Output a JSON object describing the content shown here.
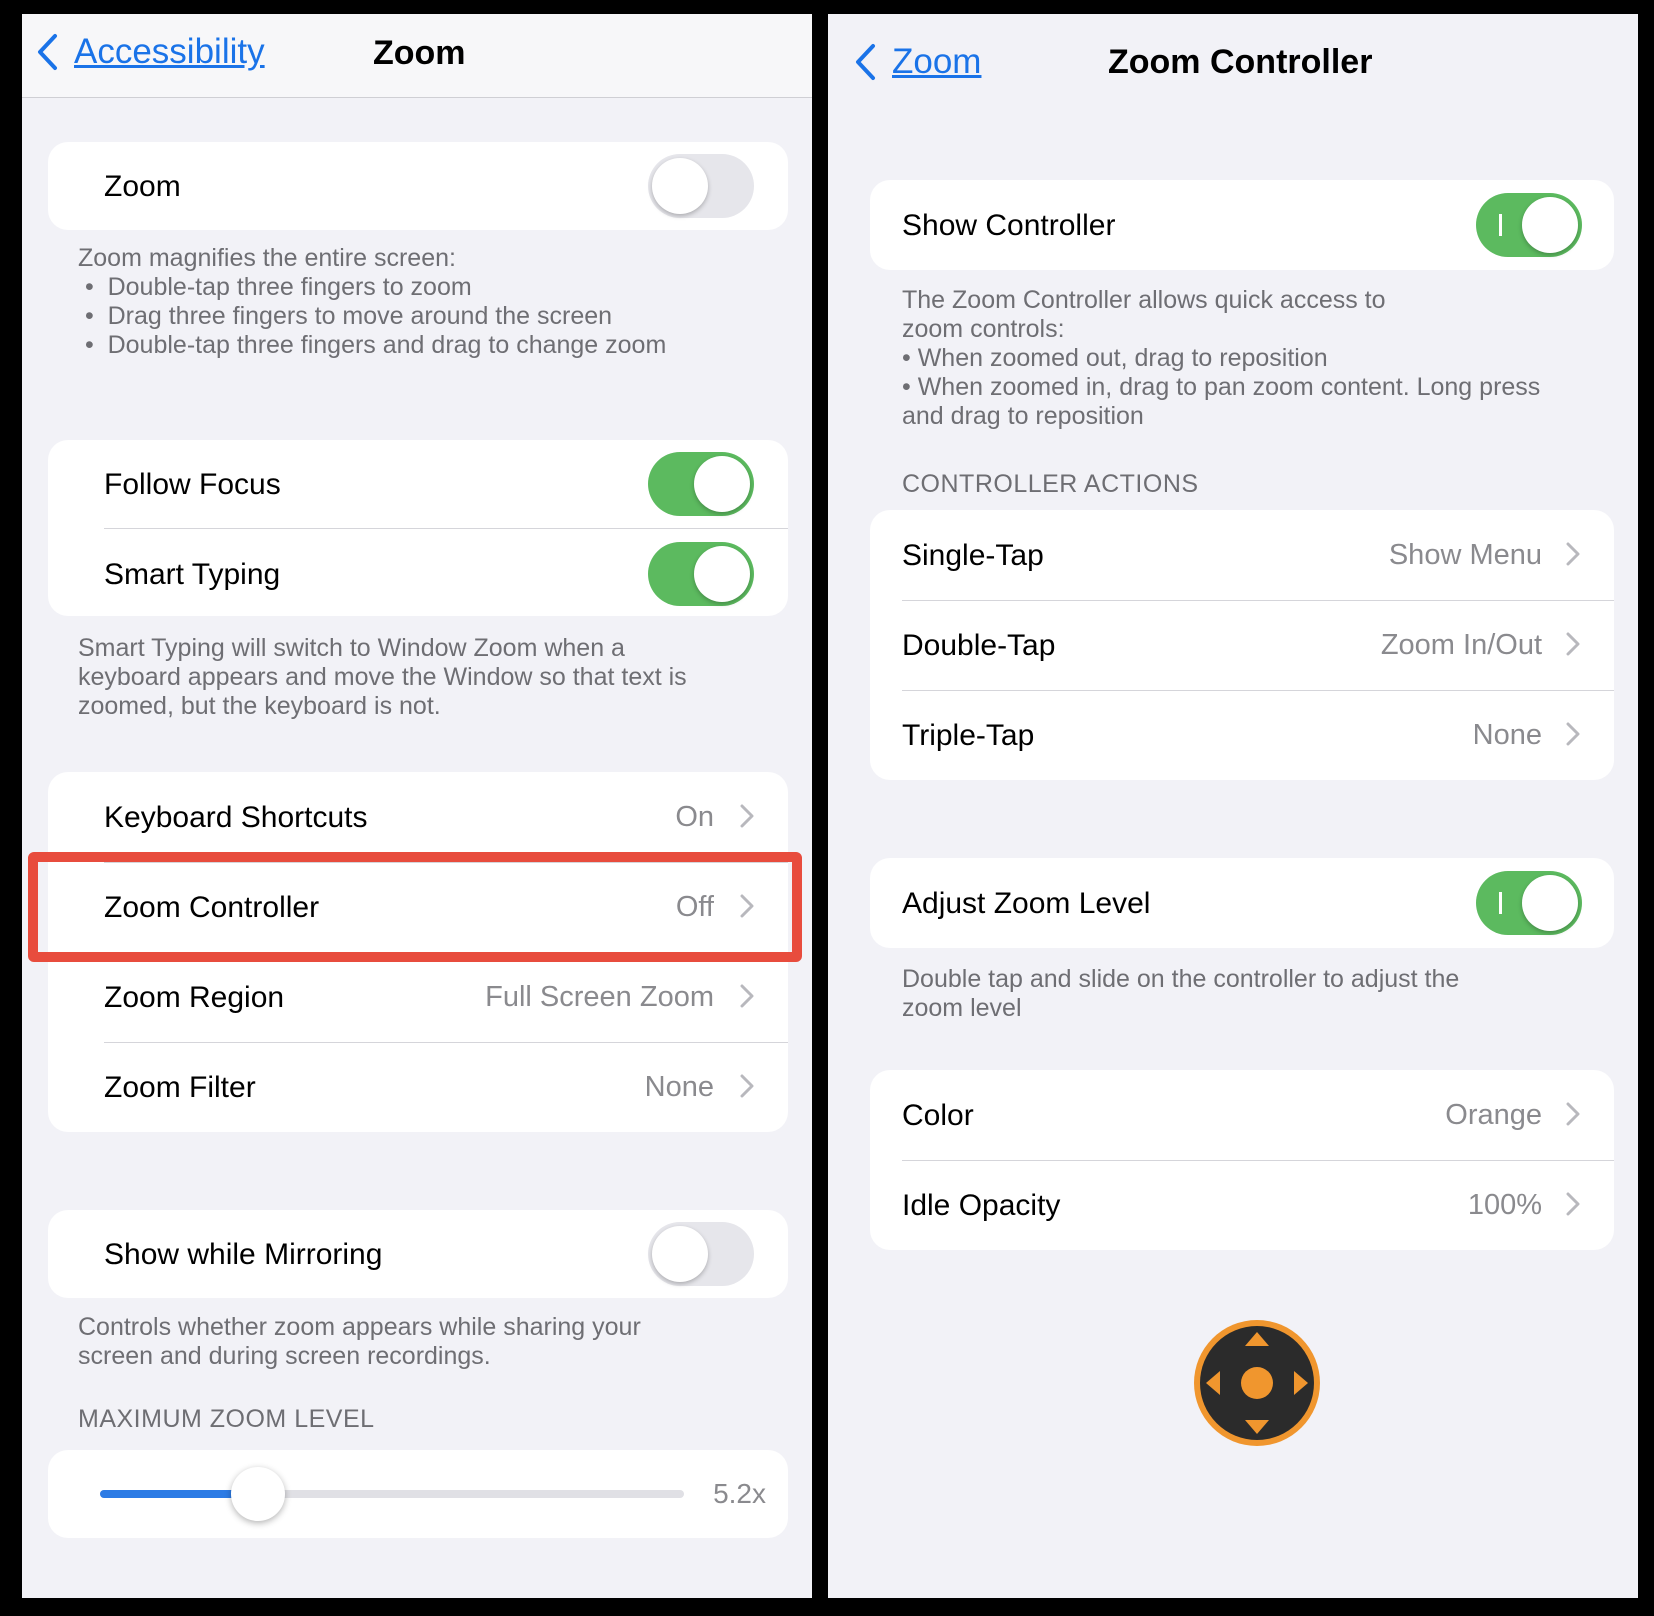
{
  "left": {
    "back_label": "Accessibility",
    "title": "Zoom",
    "zoom_row": {
      "label": "Zoom",
      "toggle": "off"
    },
    "zoom_footnote": {
      "heading": "Zoom magnifies the entire screen:",
      "bullets": [
        "Double-tap three fingers to zoom",
        "Drag three fingers to move around the screen",
        "Double-tap three fingers and drag to change zoom"
      ]
    },
    "follow_focus": {
      "label": "Follow Focus",
      "toggle": "on"
    },
    "smart_typing": {
      "label": "Smart Typing",
      "toggle": "on"
    },
    "smart_typing_footnote": [
      "Smart Typing will switch to Window Zoom when a",
      "keyboard appears and move the Window so that text is",
      "zoomed, but the keyboard is not."
    ],
    "nav_rows": [
      {
        "label": "Keyboard Shortcuts",
        "value": "On"
      },
      {
        "label": "Zoom Controller",
        "value": "Off"
      },
      {
        "label": "Zoom Region",
        "value": "Full Screen Zoom"
      },
      {
        "label": "Zoom Filter",
        "value": "None"
      }
    ],
    "show_while_mirroring": {
      "label": "Show while Mirroring",
      "toggle": "off"
    },
    "mirroring_footnote": [
      "Controls whether zoom appears while sharing your",
      "screen and during screen recordings."
    ],
    "max_zoom_header": "MAXIMUM ZOOM LEVEL",
    "max_zoom_value": "5.2x",
    "max_zoom_fraction": 0.27
  },
  "right": {
    "back_label": "Zoom",
    "title": "Zoom Controller",
    "show_controller": {
      "label": "Show Controller",
      "toggle": "on"
    },
    "show_controller_footnote": [
      "The Zoom Controller allows quick access to",
      "zoom controls:",
      "• When zoomed out, drag to reposition",
      "• When zoomed in, drag to pan zoom content. Long press",
      "and drag to reposition"
    ],
    "actions_header": "CONTROLLER ACTIONS",
    "actions": [
      {
        "label": "Single-Tap",
        "value": "Show Menu"
      },
      {
        "label": "Double-Tap",
        "value": "Zoom In/Out"
      },
      {
        "label": "Triple-Tap",
        "value": "None"
      }
    ],
    "adjust_zoom": {
      "label": "Adjust Zoom Level",
      "toggle": "on"
    },
    "adjust_zoom_footnote": [
      "Double tap and slide on the controller to adjust the",
      "zoom level"
    ],
    "appearance_rows": [
      {
        "label": "Color",
        "value": "Orange"
      },
      {
        "label": "Idle Opacity",
        "value": "100%"
      }
    ]
  },
  "colors": {
    "toggle_on": "#5cba5f",
    "highlight": "#e84c3d",
    "link": "#1a73e8",
    "controller_orange": "#f0962e"
  }
}
